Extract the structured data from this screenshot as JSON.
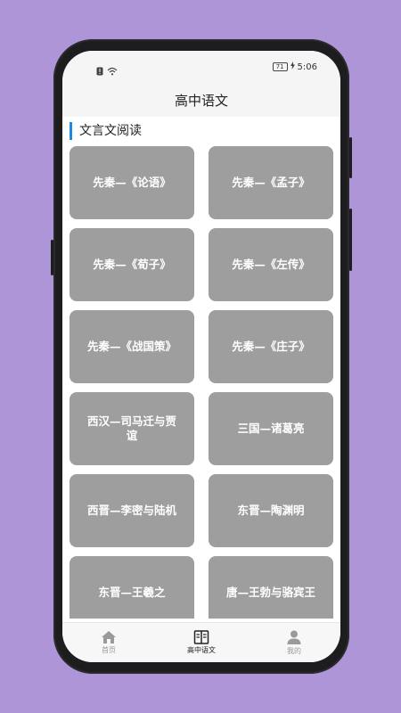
{
  "status_bar": {
    "battery_level": "71",
    "time": "5:06"
  },
  "header": {
    "title": "高中语文"
  },
  "section": {
    "title": "文言文阅读"
  },
  "cards": [
    {
      "label": "先秦—《论语》"
    },
    {
      "label": "先秦—《孟子》"
    },
    {
      "label": "先秦—《荀子》"
    },
    {
      "label": "先秦—《左传》"
    },
    {
      "label": "先秦—《战国策》"
    },
    {
      "label": "先秦—《庄子》"
    },
    {
      "label": "西汉—司马迁与贾谊"
    },
    {
      "label": "三国—诸葛亮"
    },
    {
      "label": "西晋—李密与陆机"
    },
    {
      "label": "东晋—陶渊明"
    },
    {
      "label": "东晋—王羲之"
    },
    {
      "label": "唐—王勃与骆宾王"
    }
  ],
  "tabbar": {
    "items": [
      {
        "label": "首页",
        "icon": "home-icon"
      },
      {
        "label": "高中语文",
        "icon": "book-icon"
      },
      {
        "label": "我的",
        "icon": "user-icon"
      }
    ],
    "active_index": 1
  },
  "colors": {
    "card": "#9e9e9e",
    "accent": "#1e88e5",
    "background": "#ae95d8"
  }
}
